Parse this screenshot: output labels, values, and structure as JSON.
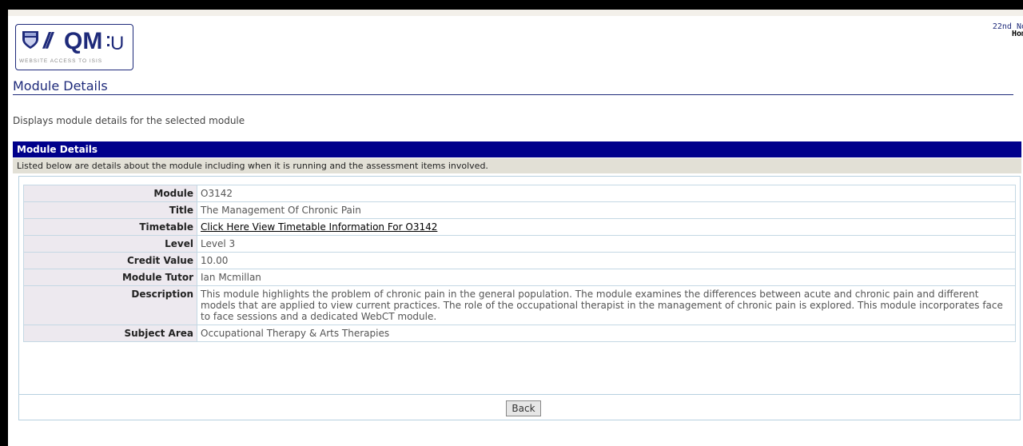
{
  "header": {
    "logo_text": "//QM:U",
    "logo_tagline": "WEBSITE ACCESS TO ISIS",
    "date_text": "22nd No",
    "home_text": "Hom"
  },
  "page": {
    "title": "Module Details",
    "description": "Displays module details for the selected module"
  },
  "section": {
    "header": "Module Details",
    "intro": "Listed below are details about the module including when it is running and the assessment items involved."
  },
  "details": [
    {
      "label": "Module",
      "value": "O3142"
    },
    {
      "label": "Title",
      "value": "The Management Of Chronic Pain"
    },
    {
      "label": "Timetable",
      "value": "Click Here View Timetable Information For O3142"
    },
    {
      "label": "Level",
      "value": "Level 3"
    },
    {
      "label": "Credit Value",
      "value": "10.00"
    },
    {
      "label": "Module Tutor",
      "value": "Ian Mcmillan"
    },
    {
      "label": "Description",
      "value": "This module highlights the problem of chronic pain in the general population. The module examines the differences between acute and chronic pain and different models that are applied to view current practices. The role of the occupational therapist in the management of chronic pain is explored. This module incorporates face to face sessions and a dedicated WebCT module."
    },
    {
      "label": "Subject Area",
      "value": "Occupational Therapy & Arts Therapies"
    }
  ],
  "actions": {
    "back_label": "Back"
  },
  "colors": {
    "brand_navy": "#1e2a7a",
    "section_header_bg": "#00008b",
    "label_bg": "#ede9ef"
  }
}
